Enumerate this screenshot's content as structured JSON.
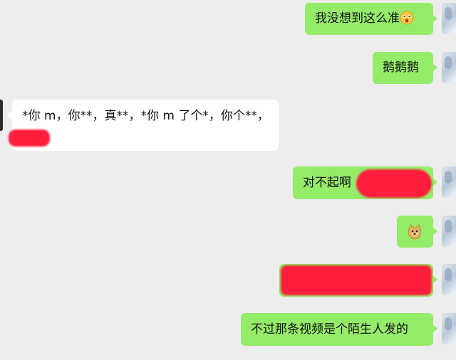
{
  "messages": [
    {
      "side": "right",
      "text": "我没想到这么准",
      "emoji": "surprised-face"
    },
    {
      "side": "right",
      "text": "鹅鹅鹅"
    },
    {
      "side": "left",
      "text": "*你 m，你**，真**，*你 m 了个*，你个**，"
    },
    {
      "side": "right",
      "text": "对不起啊"
    },
    {
      "side": "right",
      "emoji": "doge-face"
    },
    {
      "side": "right",
      "text": ""
    },
    {
      "side": "right",
      "text": "不过那条视频是个陌生人发的"
    }
  ],
  "colors": {
    "background": "#ededed",
    "self_bubble": "#95ec69",
    "other_bubble": "#ffffff",
    "redaction": "#ff1e3c"
  }
}
